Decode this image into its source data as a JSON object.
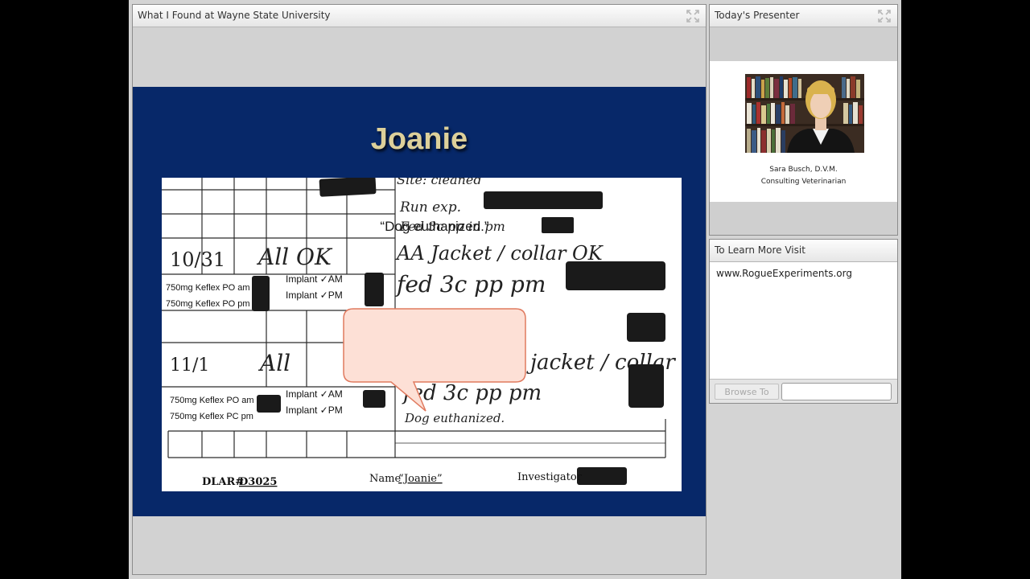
{
  "share_pod": {
    "title": "What I Found at Wayne State University",
    "fullscreen_icon": "fullscreen-icon"
  },
  "slide": {
    "title": "Joanie",
    "callout": "“Dog euthanized.”",
    "document": {
      "row1_date": "10/31",
      "row1_note": "All OK",
      "row2_date": "11/1",
      "row2_note": "All",
      "handwritten_lines": [
        "Site: cleaned",
        "Run exp.",
        "Fed 3c pp in pm",
        "AA Jacket / collar OK",
        "fed 3c pp pm",
        "jacket / collar OK",
        "fed 3c pp pm",
        "Dog euthanized."
      ],
      "med_am_1": "750mg Keflex PO am",
      "med_pm_1": "750mg Keflex PO pm",
      "med_am_2": "750mg Keflex PO am",
      "med_pm_2": "750mg Keflex PC pm",
      "implant_am": "Implant ✓AM",
      "implant_pm": "Implant ✓PM",
      "dlar_label": "DLAR#",
      "dlar_value": "D3025",
      "name_label": "Name",
      "name_value": "“Joanie”",
      "investigator_label": "Investigator"
    },
    "colors": {
      "background": "#072869",
      "title": "#ddd09a",
      "callout_fill": "#fde0d6",
      "callout_border": "#e07a5f"
    }
  },
  "presenter_pod": {
    "title": "Today's Presenter",
    "name": "Sara Busch, D.V.M.",
    "role": "Consulting Veterinarian",
    "fullscreen_icon": "fullscreen-icon"
  },
  "learn_pod": {
    "title": "To Learn More Visit",
    "link": "www.RogueExperiments.org",
    "browse_button": "Browse To",
    "url_value": ""
  }
}
